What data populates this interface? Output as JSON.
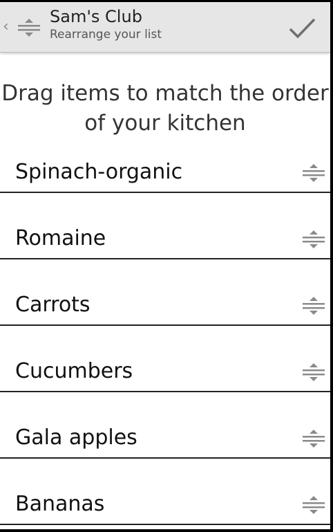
{
  "actionbar": {
    "up_caret": "‹",
    "title": "Sam's Club",
    "subtitle": "Rearrange your list",
    "app_icon": "reorder-list-icon",
    "done_icon": "checkmark-icon"
  },
  "instructions": "Drag items to match the order of your kitchen",
  "items": [
    {
      "label": "Spinach-organic",
      "handle_icon": "drag-handle-icon"
    },
    {
      "label": "Romaine",
      "handle_icon": "drag-handle-icon"
    },
    {
      "label": "Carrots",
      "handle_icon": "drag-handle-icon"
    },
    {
      "label": "Cucumbers",
      "handle_icon": "drag-handle-icon"
    },
    {
      "label": "Gala apples",
      "handle_icon": "drag-handle-icon"
    },
    {
      "label": "Bananas",
      "handle_icon": "drag-handle-icon"
    }
  ],
  "colors": {
    "actionbar_bg": "#e6e6e6",
    "text": "#111111",
    "icon": "#8a8a8a",
    "divider": "#222222"
  }
}
